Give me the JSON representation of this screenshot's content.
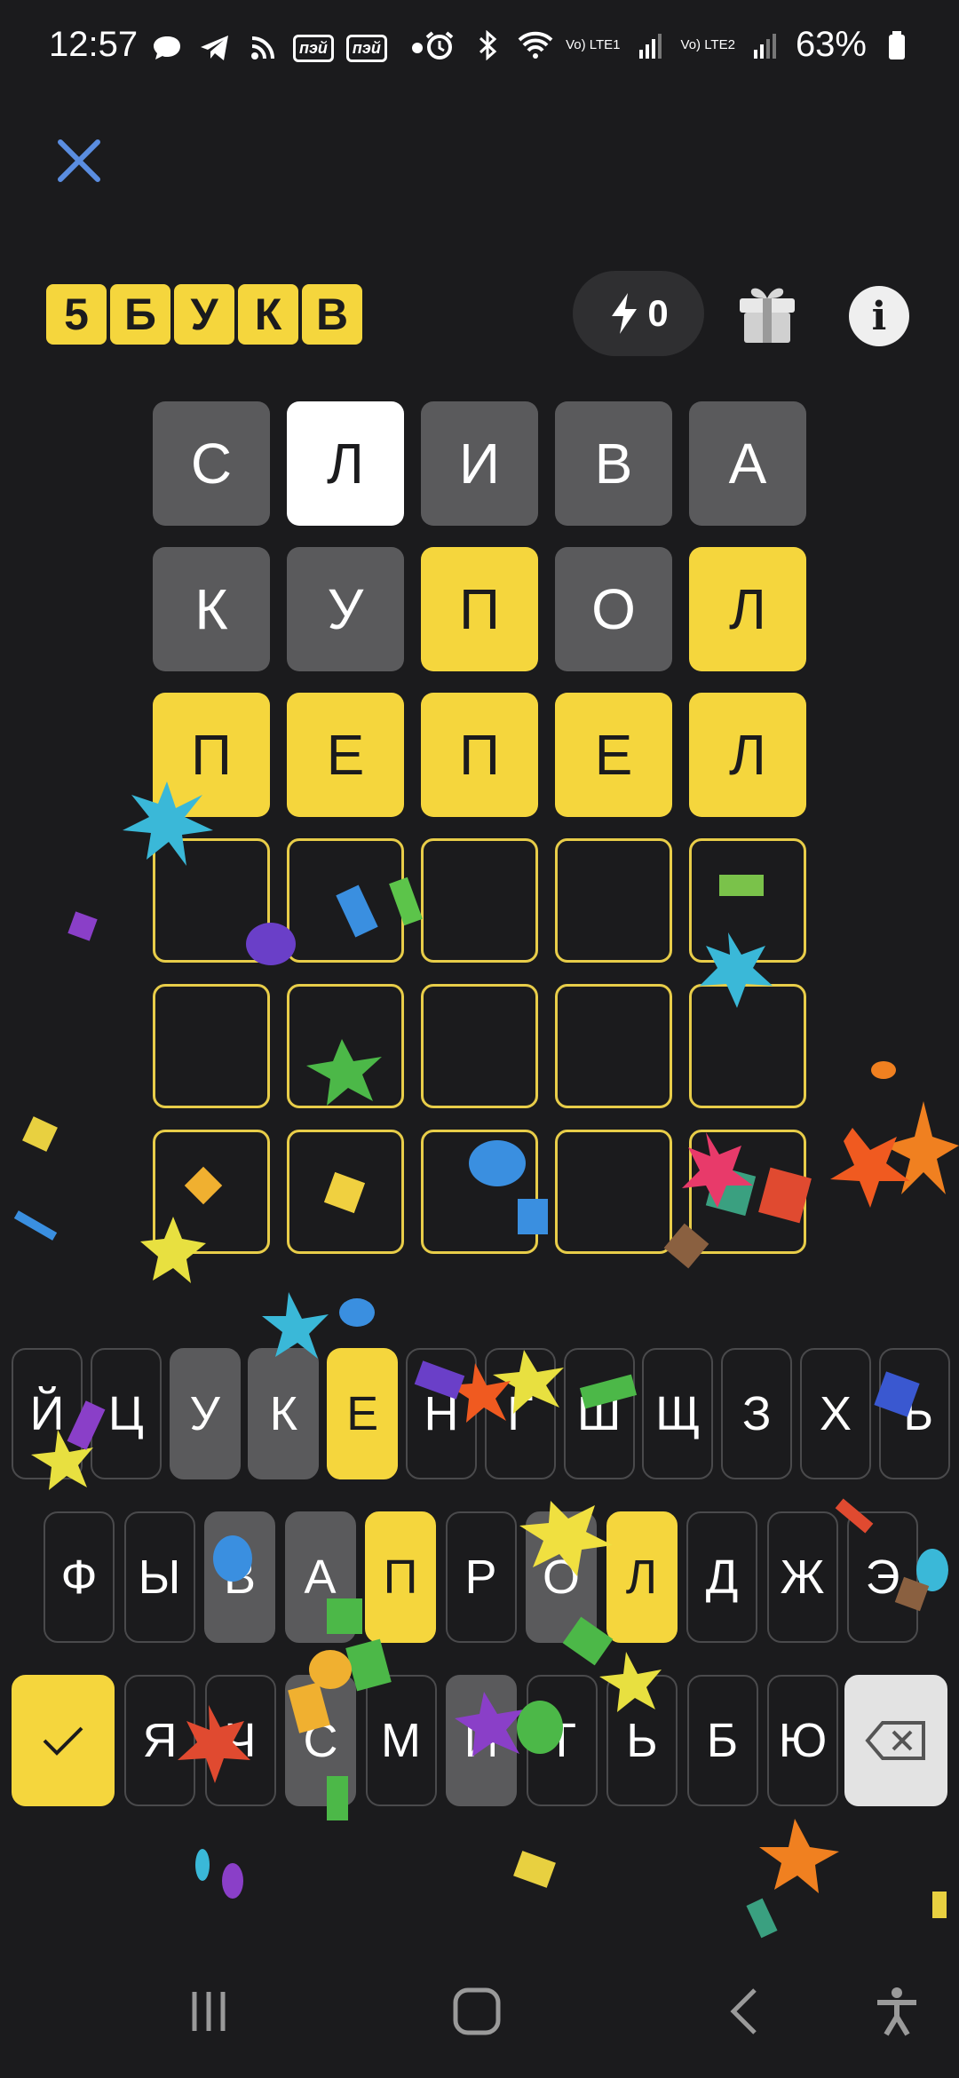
{
  "status_bar": {
    "time": "12:57",
    "battery": "63%",
    "left_icons": [
      "chat-bubble-icon",
      "telegram-icon",
      "rss-icon",
      "app-badge-icon",
      "app-badge-icon",
      "dot-icon"
    ],
    "badge_label": "пэй",
    "right_icons": [
      "alarm-icon",
      "bluetooth-icon",
      "wifi-icon",
      "lte1-signal-icon",
      "lte2-signal-icon",
      "battery-icon"
    ],
    "lte1": "Vo) LTE1",
    "lte2": "Vo) LTE2"
  },
  "header": {
    "logo": [
      "5",
      "Б",
      "У",
      "К",
      "В"
    ],
    "energy_count": "0",
    "accent_color": "#f5d63d"
  },
  "board": {
    "rows": [
      [
        {
          "l": "С",
          "s": "gray"
        },
        {
          "l": "Л",
          "s": "white"
        },
        {
          "l": "И",
          "s": "gray"
        },
        {
          "l": "В",
          "s": "gray"
        },
        {
          "l": "А",
          "s": "gray"
        }
      ],
      [
        {
          "l": "К",
          "s": "gray"
        },
        {
          "l": "У",
          "s": "gray"
        },
        {
          "l": "П",
          "s": "yellow"
        },
        {
          "l": "О",
          "s": "gray"
        },
        {
          "l": "Л",
          "s": "yellow"
        }
      ],
      [
        {
          "l": "П",
          "s": "yellow"
        },
        {
          "l": "Е",
          "s": "yellow"
        },
        {
          "l": "П",
          "s": "yellow"
        },
        {
          "l": "Е",
          "s": "yellow"
        },
        {
          "l": "Л",
          "s": "yellow"
        }
      ],
      [
        {
          "l": "",
          "s": "empty"
        },
        {
          "l": "",
          "s": "empty"
        },
        {
          "l": "",
          "s": "empty"
        },
        {
          "l": "",
          "s": "empty"
        },
        {
          "l": "",
          "s": "empty"
        }
      ],
      [
        {
          "l": "",
          "s": "empty"
        },
        {
          "l": "",
          "s": "empty"
        },
        {
          "l": "",
          "s": "empty"
        },
        {
          "l": "",
          "s": "empty"
        },
        {
          "l": "",
          "s": "empty"
        }
      ],
      [
        {
          "l": "",
          "s": "empty"
        },
        {
          "l": "",
          "s": "empty"
        },
        {
          "l": "",
          "s": "empty"
        },
        {
          "l": "",
          "s": "empty"
        },
        {
          "l": "",
          "s": "empty"
        }
      ]
    ]
  },
  "keyboard": {
    "row1": [
      {
        "k": "Й"
      },
      {
        "k": "Ц"
      },
      {
        "k": "У",
        "s": "gray"
      },
      {
        "k": "К",
        "s": "gray"
      },
      {
        "k": "Е",
        "s": "yellow"
      },
      {
        "k": "Н"
      },
      {
        "k": "Г"
      },
      {
        "k": "Ш"
      },
      {
        "k": "Щ"
      },
      {
        "k": "З"
      },
      {
        "k": "Х"
      },
      {
        "k": "Ъ"
      }
    ],
    "row2": [
      {
        "k": "Ф"
      },
      {
        "k": "Ы"
      },
      {
        "k": "В",
        "s": "gray"
      },
      {
        "k": "А",
        "s": "gray"
      },
      {
        "k": "П",
        "s": "yellow"
      },
      {
        "k": "Р"
      },
      {
        "k": "О",
        "s": "gray"
      },
      {
        "k": "Л",
        "s": "yellow"
      },
      {
        "k": "Д"
      },
      {
        "k": "Ж"
      },
      {
        "k": "Э"
      }
    ],
    "row3": [
      {
        "k": "Я"
      },
      {
        "k": "Ч"
      },
      {
        "k": "С",
        "s": "gray"
      },
      {
        "k": "М"
      },
      {
        "k": "И",
        "s": "gray"
      },
      {
        "k": "Т"
      },
      {
        "k": "Ь"
      },
      {
        "k": "Б"
      },
      {
        "k": "Ю"
      }
    ],
    "enter_icon": "checkmark-icon",
    "backspace_icon": "backspace-icon"
  },
  "navbar": {
    "icons": [
      "recent-apps-icon",
      "home-icon",
      "back-icon",
      "accessibility-icon"
    ]
  }
}
